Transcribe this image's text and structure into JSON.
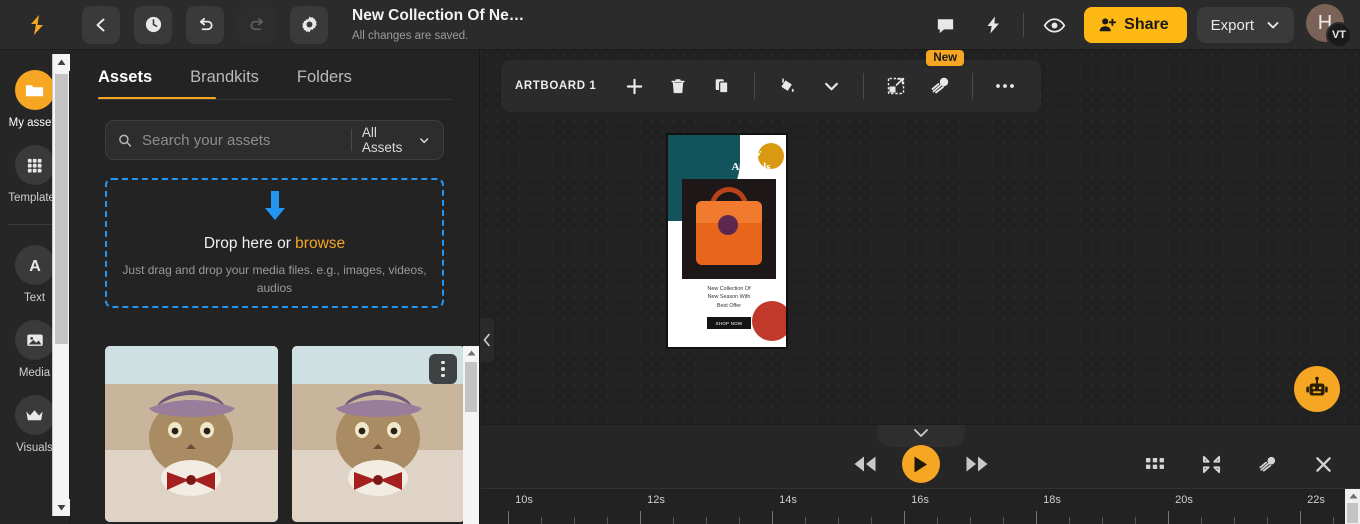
{
  "topbar": {
    "logo_icon": "brand-logo",
    "back_icon": "chevron-left-icon",
    "history_icon": "clock-icon",
    "undo_icon": "undo-icon",
    "redo_icon": "redo-icon",
    "settings_icon": "gear-icon",
    "doc_title": "New Collection Of Ne…",
    "doc_status": "All changes are saved.",
    "comment_icon": "comment-icon",
    "bolt_icon": "lightning-icon",
    "preview_icon": "eye-icon",
    "share_label": "Share",
    "share_icon": "user-plus-icon",
    "export_label": "Export",
    "export_chevron_icon": "chevron-down-icon",
    "avatar_initial": "H",
    "avatar_badge": "VT",
    "accent_color": "#f5a623",
    "share_color": "#fdb813"
  },
  "rail": {
    "items": [
      {
        "label": "My assets",
        "icon": "folder-icon",
        "active": true
      },
      {
        "label": "Templates",
        "icon": "grid-icon",
        "active": false
      },
      {
        "label": "Text",
        "icon": "letter-a-icon",
        "active": false
      },
      {
        "label": "Media",
        "icon": "image-icon",
        "active": false
      },
      {
        "label": "Visuals",
        "icon": "crown-icon",
        "active": false
      }
    ]
  },
  "panel": {
    "tabs": [
      {
        "label": "Assets",
        "active": true
      },
      {
        "label": "Brandkits",
        "active": false
      },
      {
        "label": "Folders",
        "active": false
      }
    ],
    "search": {
      "icon": "search-icon",
      "placeholder": "Search your assets",
      "value": "",
      "filter_label": "All Assets",
      "filter_icon": "chevron-down-icon"
    },
    "dropzone": {
      "arrow_icon": "download-arrow-icon",
      "title_prefix": "Drop here or ",
      "title_link": "browse",
      "subtitle": "Just drag and drop your media files. e.g., images, videos, audios",
      "border_color": "#2196f3"
    },
    "assets": [
      {
        "name": "cat-in-hat-thumbnail-1",
        "has_menu": false
      },
      {
        "name": "cat-in-hat-thumbnail-2",
        "has_menu": true
      }
    ],
    "kebab_icon": "more-vertical-icon",
    "collapse_icon": "chevron-left-icon"
  },
  "canvas": {
    "toolbar": {
      "artboard_label": "ARTBOARD 1",
      "add_icon": "plus-icon",
      "delete_icon": "trash-icon",
      "duplicate_icon": "copy-icon",
      "fill_icon": "paint-bucket-icon",
      "fill_chevron_icon": "chevron-down-icon",
      "resize_icon": "resize-icon",
      "magic_icon": "magic-wand-icon",
      "new_badge": "New",
      "more_icon": "more-horizontal-icon"
    },
    "artboard": {
      "heading_line1": "New",
      "heading_line2": "Arrivals",
      "caption_line1": "New Collection Of",
      "caption_line2": "New Season With",
      "caption_line3": "Best Offer",
      "cta_label": "SHOP NOW",
      "teal_color": "#13535b",
      "bag_color": "#e8661c"
    },
    "ai_assistant_icon": "robot-icon"
  },
  "playback": {
    "collapse_icon": "chevron-down-icon",
    "rewind_icon": "rewind-icon",
    "play_icon": "play-icon",
    "forward_icon": "fast-forward-icon",
    "grid_icon": "grid-view-icon",
    "fit_icon": "collapse-fit-icon",
    "magic_icon": "magic-wand-icon",
    "close_icon": "close-icon"
  },
  "timeline": {
    "ticks": [
      "10s",
      "12s",
      "14s",
      "16s",
      "18s",
      "20s",
      "22s"
    ],
    "tick_positions": [
      27,
      159,
      291,
      423,
      555,
      687,
      819
    ],
    "minor_per_major": 4,
    "minor_spacing": 33
  }
}
